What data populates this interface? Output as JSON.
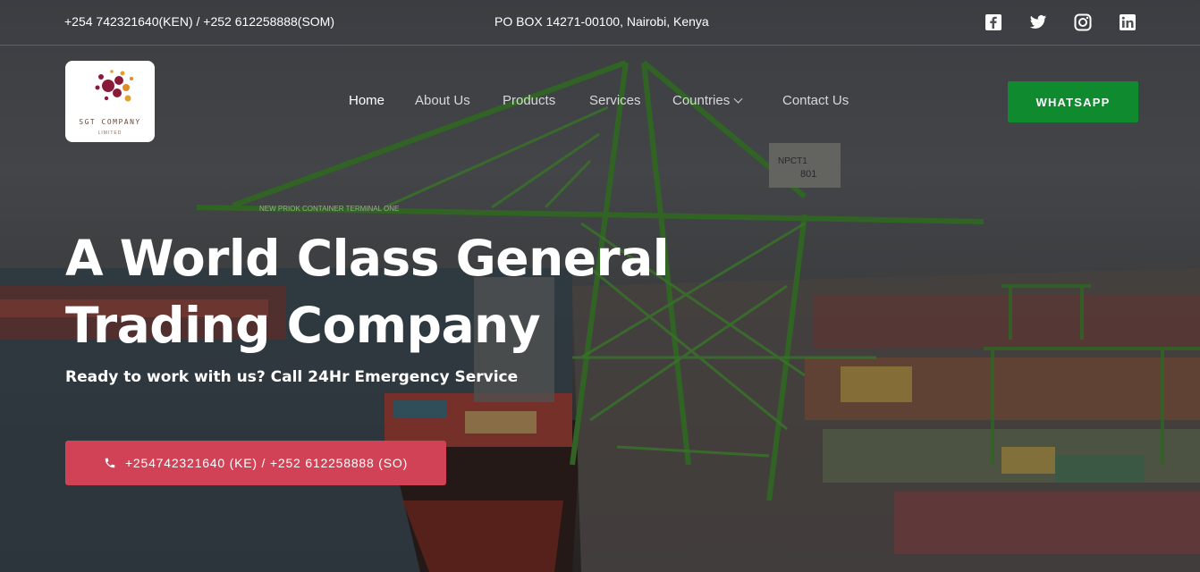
{
  "topbar": {
    "phones": "+254 742321640(KEN) / +252 612258888(SOM)",
    "address": "PO BOX 14271-00100, Nairobi, Kenya",
    "social": [
      "facebook-icon",
      "twitter-icon",
      "instagram-icon",
      "linkedin-icon"
    ]
  },
  "logo": {
    "brand": "SGT COMPANY",
    "sub": "LIMITED"
  },
  "nav": {
    "items": [
      {
        "label": "Home"
      },
      {
        "label": "About Us"
      },
      {
        "label": "Products"
      },
      {
        "label": "Services"
      },
      {
        "label": "Countries"
      },
      {
        "label": "Contact Us"
      }
    ]
  },
  "whatsapp_label": "WHATSAPP",
  "hero": {
    "headline_line1": "A World Class General",
    "headline_line2": "Trading Company",
    "tagline": "Ready to work with us? Call 24Hr Emergency Service",
    "cta_label": "+254742321640 (KE) / +252 612258888 (SO)",
    "crane_labels": [
      "NEW PRIOK CONTAINER TERMINAL ONE",
      "NPCT1",
      "801"
    ]
  },
  "colors": {
    "cta": "#d14256",
    "whatsapp": "#0f8a2f",
    "crane": "#3f8a2c"
  }
}
